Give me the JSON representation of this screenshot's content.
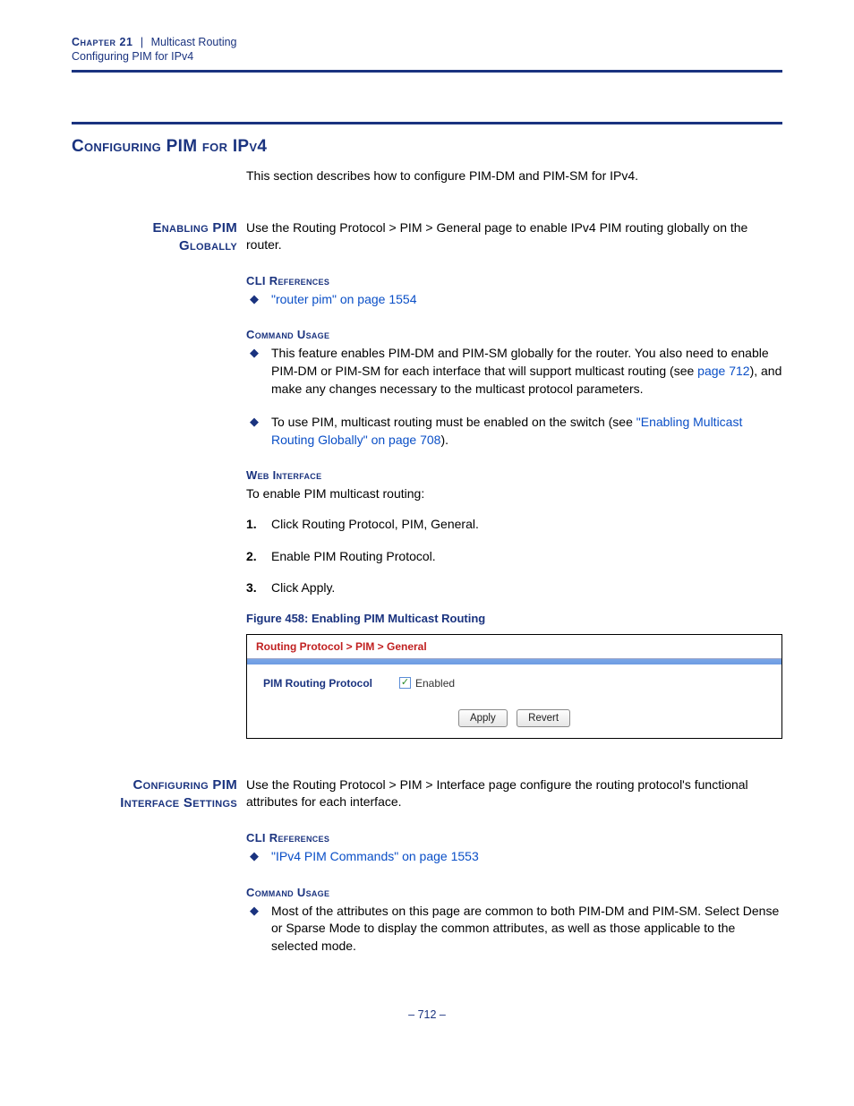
{
  "header": {
    "chapter": "Chapter 21",
    "sep": "|",
    "title": "Multicast Routing",
    "subtitle": "Configuring PIM for IPv4"
  },
  "sectionTitle": "Configuring PIM for IPv4",
  "intro": "This section describes how to configure PIM-DM and PIM-SM for IPv4.",
  "s1": {
    "side1": "Enabling PIM",
    "side2": "Globally",
    "intro": "Use the Routing Protocol > PIM > General page to enable IPv4 PIM routing globally on the router.",
    "cliHead": "CLI References",
    "cliLink": "\"router pim\" on page 1554",
    "cuHead": "Command Usage",
    "cu1a": "This feature enables PIM-DM and PIM-SM globally for the router. You also need to enable PIM-DM or PIM-SM for each interface that will support multicast routing (see ",
    "cu1link": "page 712",
    "cu1b": "), and make any changes necessary to the multicast protocol parameters.",
    "cu2a": "To use PIM, multicast routing must be enabled on the switch (see ",
    "cu2link": "\"Enabling Multicast Routing Globally\" on page 708",
    "cu2b": ").",
    "wiHead": "Web Interface",
    "wiIntro": "To enable PIM multicast routing:",
    "step1": "Click Routing Protocol, PIM, General.",
    "step2": "Enable PIM Routing Protocol.",
    "step3": "Click Apply.",
    "figCap": "Figure 458:  Enabling PIM Multicast Routing",
    "fig": {
      "breadcrumb": "Routing Protocol > PIM > General",
      "label": "PIM Routing Protocol",
      "checkLabel": "Enabled",
      "checkMark": "✓",
      "btnApply": "Apply",
      "btnRevert": "Revert"
    }
  },
  "s2": {
    "side1": "Configuring PIM",
    "side2": "Interface Settings",
    "intro": "Use the Routing Protocol > PIM > Interface page configure the routing protocol's functional attributes for each interface.",
    "cliHead": "CLI References",
    "cliLink": "\"IPv4 PIM Commands\" on page 1553",
    "cuHead": "Command Usage",
    "cu1": "Most of the attributes on this page are common to both PIM-DM and PIM-SM. Select Dense or Sparse Mode to display the common attributes, as well as those applicable to the selected mode."
  },
  "pageNum": "–  712  –"
}
